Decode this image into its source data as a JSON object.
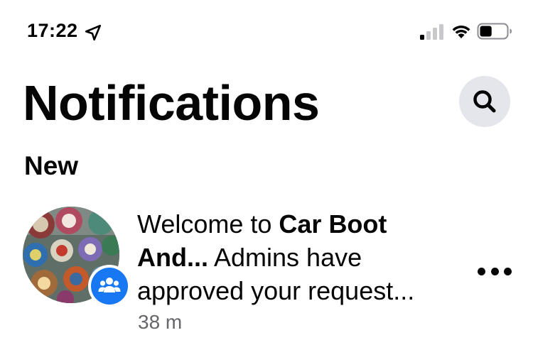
{
  "status_bar": {
    "time": "17:22",
    "location_icon": "location-arrow-icon",
    "signal_icon": "cellular-signal-icon",
    "wifi_icon": "wifi-icon",
    "battery_icon": "battery-icon",
    "battery_level": 0.45
  },
  "header": {
    "title": "Notifications",
    "search_icon": "search-icon"
  },
  "sections": [
    {
      "title": "New",
      "items": [
        {
          "avatar": "group-photo-avatar",
          "badge_icon": "group-icon",
          "text_plain_1": "Welcome to ",
          "text_bold": "Car Boot And...",
          "text_plain_2": " Admins have approved your request...",
          "time": "38 m",
          "more_icon": "more-horizontal-icon"
        }
      ]
    }
  ],
  "colors": {
    "accent": "#1877f2",
    "text": "#050505",
    "secondary_text": "#65676b",
    "button_bg": "#e4e6eb"
  }
}
